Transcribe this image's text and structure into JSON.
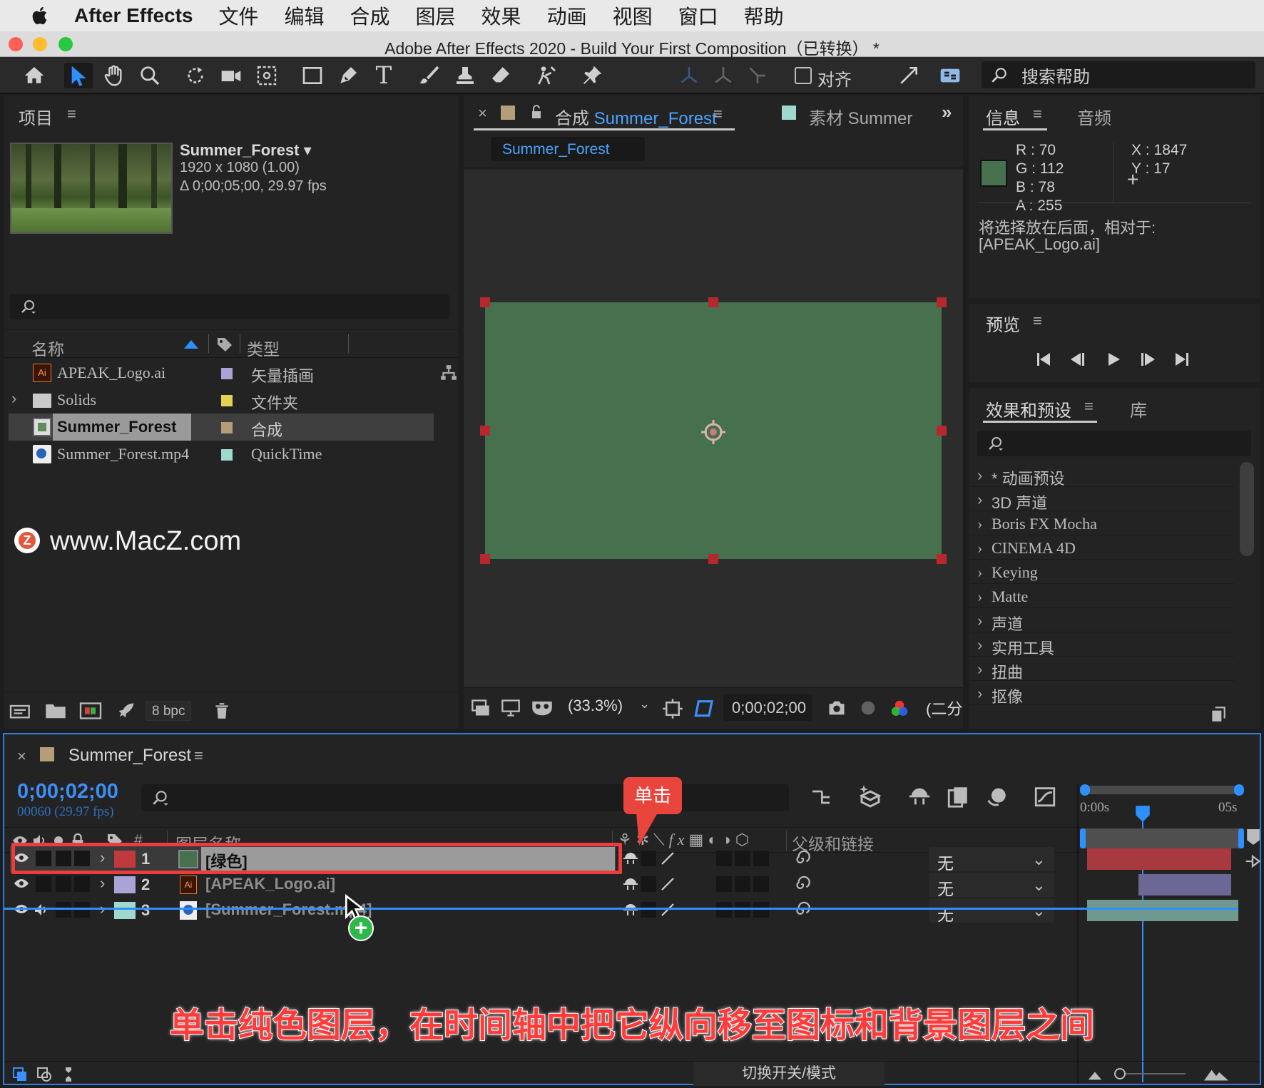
{
  "menubar": {
    "app": "After Effects",
    "items": [
      "文件",
      "编辑",
      "合成",
      "图层",
      "效果",
      "动画",
      "视图",
      "窗口",
      "帮助"
    ]
  },
  "window": {
    "title": "Adobe After Effects 2020 - Build Your First Composition（已转换） *"
  },
  "toolbar": {
    "snap_label": "对齐",
    "search_help": "搜索帮助"
  },
  "project": {
    "tab": "项目",
    "selected": {
      "name": "Summer_Forest ▾",
      "resolution": "1920 x 1080 (1.00)",
      "duration": "Δ 0;00;05;00, 29.97 fps"
    },
    "columns": {
      "name": "名称",
      "type": "类型"
    },
    "items": [
      {
        "name": "APEAK_Logo.ai",
        "type": "矢量插画",
        "color": "#a9a3d6"
      },
      {
        "name": "Solids",
        "type": "文件夹",
        "color": "#e3d256"
      },
      {
        "name": "Summer_Forest",
        "type": "合成",
        "color": "#b39e78"
      },
      {
        "name": "Summer_Forest.mp4",
        "type": "QuickTime",
        "color": "#9fd8cf"
      }
    ],
    "bpc": "8 bpc",
    "watermark": "www.MacZ.com"
  },
  "comp": {
    "tab_prefix": "合成",
    "tab_name": "Summer_Forest",
    "footage_tab": "素材 Summer",
    "crumb": "Summer_Forest",
    "solid_color": "#46704e",
    "zoom": "(33.3%)",
    "timecode": "0;00;02;00",
    "resolution": "(二分"
  },
  "info": {
    "tab": "信息",
    "audio_tab": "音频",
    "r_label": "R :",
    "r": "70",
    "g_label": "G :",
    "g": "112",
    "b_label": "B :",
    "b": "78",
    "a_label": "A :",
    "a": "255",
    "x_label": "X :",
    "x": "1847",
    "y_label": "Y :",
    "y": "17",
    "swatch": "#46704e",
    "msg1": "将选择放在后面，相对于:",
    "msg2": "[APEAK_Logo.ai]"
  },
  "preview": {
    "tab": "预览"
  },
  "effects": {
    "tab": "效果和预设",
    "lib_tab": "库",
    "items": [
      "* 动画预设",
      "3D 声道",
      "Boris FX Mocha",
      "CINEMA 4D",
      "Keying",
      "Matte",
      "声道",
      "实用工具",
      "扭曲",
      "抠像"
    ]
  },
  "timeline": {
    "tab": "Summer_Forest",
    "timecode": "0;00;02;00",
    "frames": "00060 (29.97 fps)",
    "col_num": "#",
    "col_name": "图层名称",
    "col_parent": "父级和链接",
    "ruler_start": "0:00s",
    "ruler_end": "05s",
    "layers": [
      {
        "num": "1",
        "name": "[绿色]",
        "color": "#c0393d",
        "parent": "无"
      },
      {
        "num": "2",
        "name": "[APEAK_Logo.ai]",
        "color": "#a9a3d6",
        "parent": "无"
      },
      {
        "num": "3",
        "name": "[Summer_Forest.mp4]",
        "color": "#9fd8cf",
        "parent": "无"
      }
    ],
    "toggle": "切换开关/模式"
  },
  "annotation": {
    "callout": "单击",
    "caption": "单击纯色图层，在时间轴中把它纵向移至图标和背景图层之间"
  }
}
